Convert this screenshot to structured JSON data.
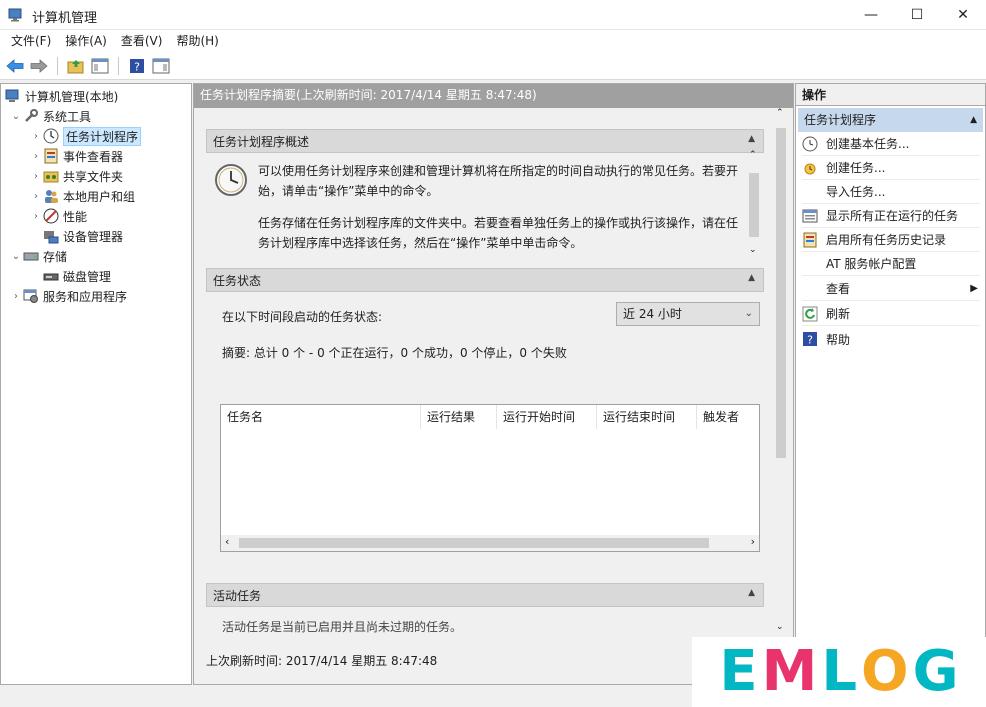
{
  "window": {
    "title": "计算机管理",
    "controls": {
      "minimize": "—",
      "maximize": "☐",
      "close": "✕"
    }
  },
  "menu": [
    "文件(F)",
    "操作(A)",
    "查看(V)",
    "帮助(H)"
  ],
  "tree": {
    "root": "计算机管理(本地)",
    "items": [
      {
        "label": "系统工具",
        "icon": "tools-icon"
      },
      {
        "label": "任务计划程序",
        "icon": "clock-icon"
      },
      {
        "label": "事件查看器",
        "icon": "event-viewer-icon"
      },
      {
        "label": "共享文件夹",
        "icon": "shared-folder-icon"
      },
      {
        "label": "本地用户和组",
        "icon": "users-icon"
      },
      {
        "label": "性能",
        "icon": "performance-icon"
      },
      {
        "label": "设备管理器",
        "icon": "device-manager-icon"
      },
      {
        "label": "存储",
        "icon": "storage-icon"
      },
      {
        "label": "磁盘管理",
        "icon": "disk-icon"
      },
      {
        "label": "服务和应用程序",
        "icon": "services-icon"
      }
    ]
  },
  "center": {
    "header": "任务计划程序摘要(上次刷新时间: 2017/4/14 星期五 8:47:48)",
    "overview": {
      "title": "任务计划程序概述",
      "para1": "可以使用任务计划程序来创建和管理计算机将在所指定的时间自动执行的常见任务。若要开始，请单击“操作”菜单中的命令。",
      "para2": "任务存储在任务计划程序库的文件夹中。若要查看单独任务上的操作或执行该操作，请在任务计划程序库中选择该任务，然后在“操作”菜单中单击命令。"
    },
    "status": {
      "title": "任务状态",
      "period_label": "在以下时间段启动的任务状态:",
      "period_value": "近 24 小时",
      "summary": "摘要: 总计 0 个 - 0 个正在运行，0 个成功，0 个停止，0 个失败",
      "columns": [
        "任务名",
        "运行结果",
        "运行开始时间",
        "运行结束时间",
        "触发者"
      ]
    },
    "active": {
      "title": "活动任务",
      "partial_text": "活动任务是当前已启用并且尚未过期的任务。"
    },
    "footer": "上次刷新时间: 2017/4/14 星期五 8:47:48"
  },
  "actions": {
    "title": "操作",
    "group": "任务计划程序",
    "items": [
      {
        "label": "创建基本任务...",
        "icon": "create-basic-task-icon"
      },
      {
        "label": "创建任务...",
        "icon": "create-task-icon"
      },
      {
        "label": "导入任务...",
        "icon": ""
      },
      {
        "label": "显示所有正在运行的任务",
        "icon": "running-tasks-icon"
      },
      {
        "label": "启用所有任务历史记录",
        "icon": "history-icon"
      },
      {
        "label": "AT 服务帐户配置",
        "icon": ""
      },
      {
        "label": "查看",
        "icon": ""
      },
      {
        "label": "刷新",
        "icon": "refresh-icon"
      },
      {
        "label": "帮助",
        "icon": "help-icon"
      }
    ]
  },
  "watermark": {
    "letters": [
      "E",
      "M",
      "L",
      "O",
      "G"
    ],
    "colors": [
      "#00b7c3",
      "#e8336d",
      "#00b7c3",
      "#f5a623",
      "#00b7c3"
    ]
  }
}
